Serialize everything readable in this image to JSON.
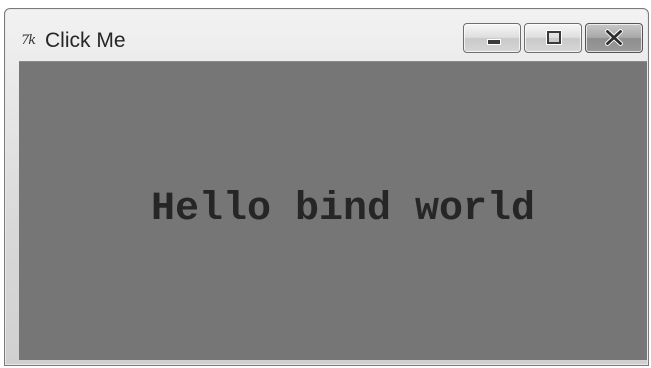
{
  "window": {
    "title": "Click Me",
    "icon": "tk-feather-icon",
    "caption_buttons": {
      "minimize": "minimize-icon",
      "maximize": "maximize-icon",
      "close": "close-icon"
    }
  },
  "content": {
    "label_text": "Hello bind world",
    "background_color": "#767676",
    "text_color": "#262626"
  }
}
